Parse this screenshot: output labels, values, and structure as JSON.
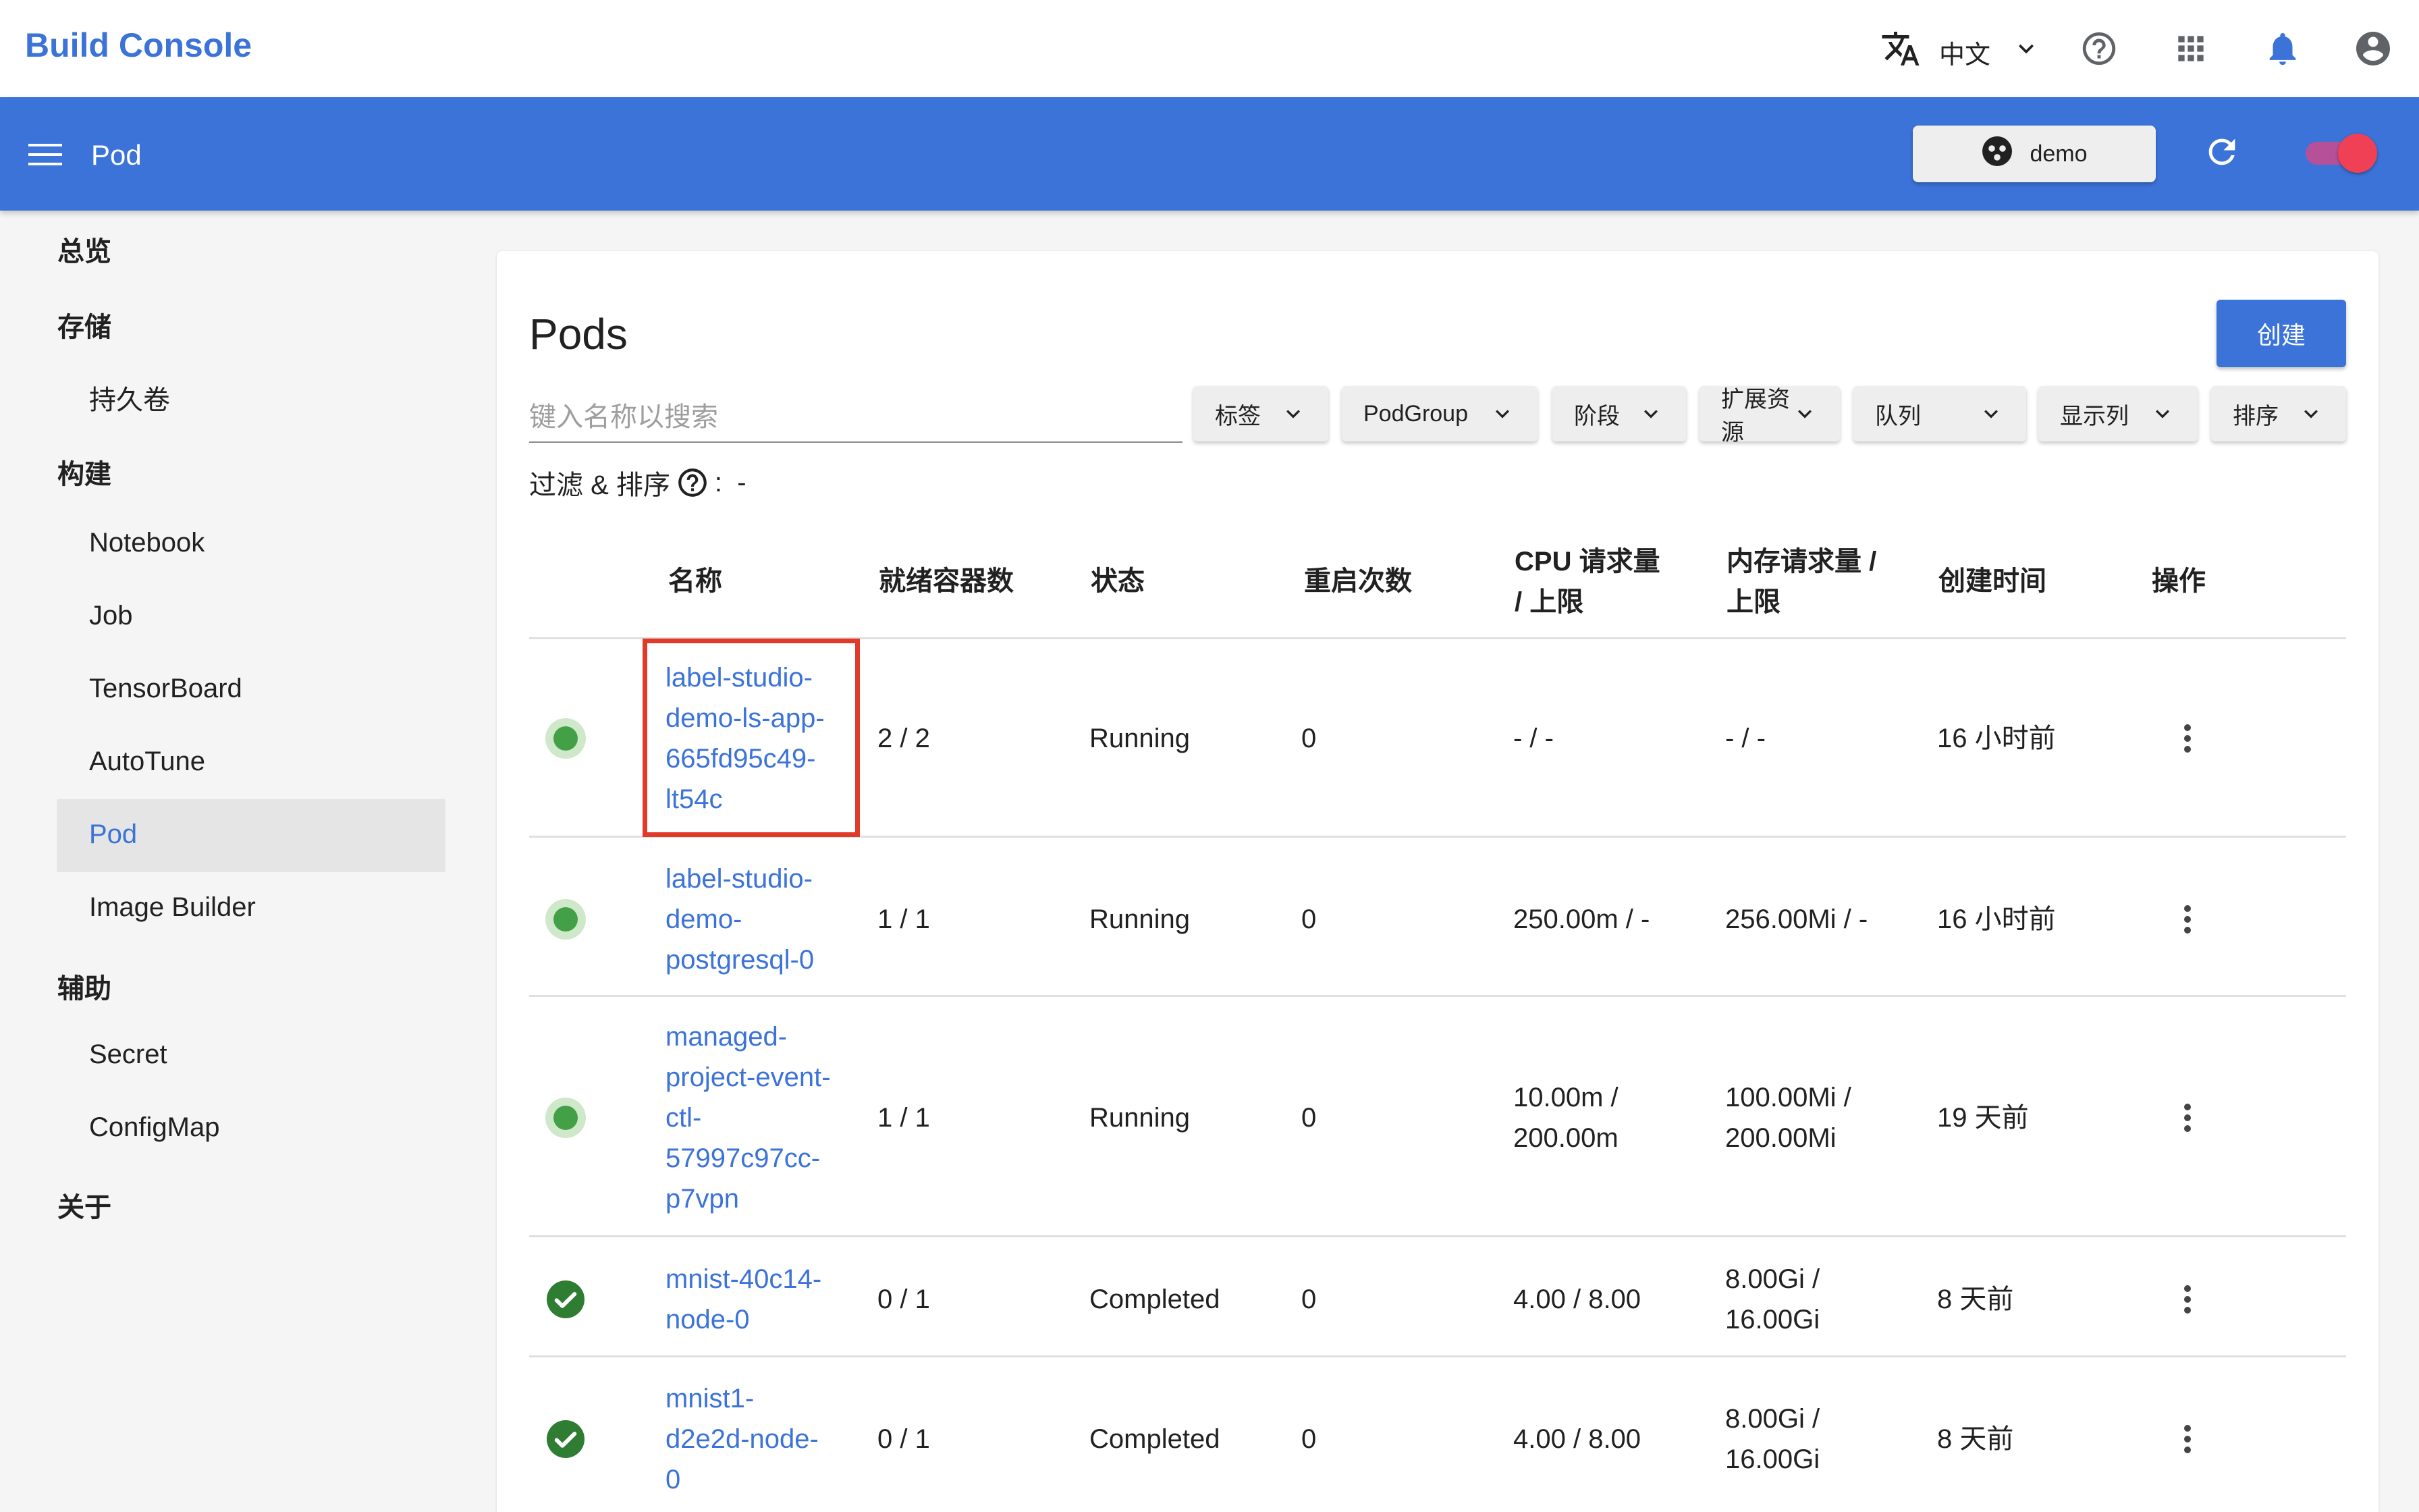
{
  "app": {
    "title": "Build Console"
  },
  "topbar": {
    "language": "中文"
  },
  "toolbar": {
    "title": "Pod",
    "namespace": "demo"
  },
  "sidebar": {
    "items": [
      {
        "label": "总览",
        "type": "section"
      },
      {
        "label": "存储",
        "type": "section"
      },
      {
        "label": "持久卷",
        "type": "child"
      },
      {
        "label": "构建",
        "type": "section"
      },
      {
        "label": "Notebook",
        "type": "child"
      },
      {
        "label": "Job",
        "type": "child"
      },
      {
        "label": "TensorBoard",
        "type": "child"
      },
      {
        "label": "AutoTune",
        "type": "child"
      },
      {
        "label": "Pod",
        "type": "child",
        "active": true
      },
      {
        "label": "Image Builder",
        "type": "child"
      },
      {
        "label": "辅助",
        "type": "section"
      },
      {
        "label": "Secret",
        "type": "child"
      },
      {
        "label": "ConfigMap",
        "type": "child"
      },
      {
        "label": "关于",
        "type": "section"
      }
    ]
  },
  "main": {
    "title": "Pods",
    "create_label": "创建",
    "search_placeholder": "键入名称以搜索",
    "filters": [
      "标签",
      "PodGroup",
      "阶段",
      "扩展资源",
      "队列",
      "显示列",
      "排序"
    ],
    "filter_status_label": "过滤 & 排序",
    "filter_status_value": ":  -"
  },
  "table": {
    "headers": [
      "名称",
      "就绪容器数",
      "状态",
      "重启次数",
      "CPU 请求量 / 上限",
      "内存请求量 / 上限",
      "创建时间",
      "操作"
    ],
    "header_lines": {
      "cpu": [
        "CPU 请求量",
        "/ 上限"
      ],
      "mem": [
        "内存请求量 /",
        "上限"
      ]
    },
    "rows": [
      {
        "name_lines": [
          "label-studio-",
          "demo-ls-app-",
          "665fd95c49-",
          "lt54c"
        ],
        "ready": "2 / 2",
        "status": "Running",
        "restarts": "0",
        "cpu_lines": [
          "- / -"
        ],
        "mem_lines": [
          "- / -"
        ],
        "created": "16 小时前",
        "state": "running",
        "highlighted": true
      },
      {
        "name_lines": [
          "label-studio-",
          "demo-",
          "postgresql-0"
        ],
        "ready": "1 / 1",
        "status": "Running",
        "restarts": "0",
        "cpu_lines": [
          "250.00m / -"
        ],
        "mem_lines": [
          "256.00Mi / -"
        ],
        "created": "16 小时前",
        "state": "running"
      },
      {
        "name_lines": [
          "managed-",
          "project-event-",
          "ctl-",
          "57997c97cc-",
          "p7vpn"
        ],
        "ready": "1 / 1",
        "status": "Running",
        "restarts": "0",
        "cpu_lines": [
          "10.00m /",
          "200.00m"
        ],
        "mem_lines": [
          "100.00Mi /",
          "200.00Mi"
        ],
        "created": "19 天前",
        "state": "running"
      },
      {
        "name_lines": [
          "mnist-40c14-",
          "node-0"
        ],
        "ready": "0 / 1",
        "status": "Completed",
        "restarts": "0",
        "cpu_lines": [
          "4.00 / 8.00"
        ],
        "mem_lines": [
          "8.00Gi /",
          "16.00Gi"
        ],
        "created": "8 天前",
        "state": "completed"
      },
      {
        "name_lines": [
          "mnist1-",
          "d2e2d-node-",
          "0"
        ],
        "ready": "0 / 1",
        "status": "Completed",
        "restarts": "0",
        "cpu_lines": [
          "4.00 / 8.00"
        ],
        "mem_lines": [
          "8.00Gi /",
          "16.00Gi"
        ],
        "created": "8 天前",
        "state": "completed"
      }
    ]
  },
  "colors": {
    "brand": "#3b73d9",
    "running": "#43a047",
    "completed": "#2e7d32",
    "highlight": "#e03a2b",
    "toggle_thumb": "#ef4055"
  },
  "icons": [
    "translate-icon",
    "chevron-down-icon",
    "help-icon",
    "apps-icon",
    "bell-icon",
    "account-icon",
    "menu-icon",
    "namespace-icon",
    "refresh-icon",
    "kebab-icon",
    "check-circle-icon"
  ]
}
